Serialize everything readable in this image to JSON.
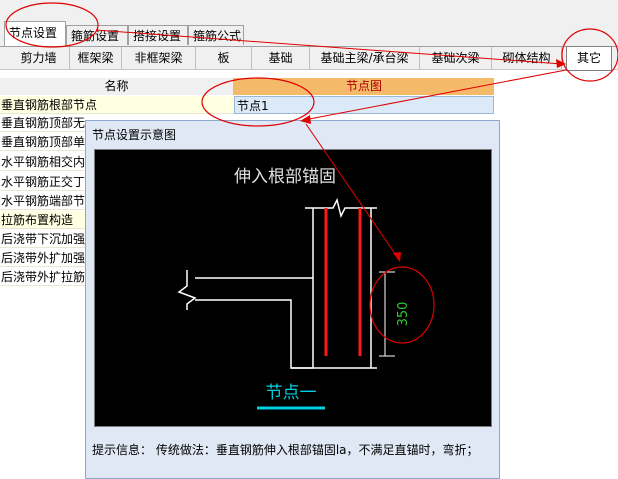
{
  "top_tabs": [
    "节点设置",
    "箍筋设置",
    "搭接设置",
    "箍筋公式"
  ],
  "sub_tabs": [
    "剪力墙",
    "框架梁",
    "非框架梁",
    "板",
    "基础",
    "基础主梁/承台梁",
    "基础次梁",
    "砌体结构",
    "其它"
  ],
  "grid": {
    "col_name": "名称",
    "col_node": "节点图",
    "rows": [
      "垂直钢筋根部节点",
      "垂直钢筋顶部无",
      "垂直钢筋顶部单",
      "水平钢筋相交内",
      "水平钢筋正交丁",
      "水平钢筋端部节",
      "拉筋布置构造",
      "后浇带下沉加强",
      "后浇带外扩加强",
      "后浇带外扩拉筋"
    ],
    "selected_value": "节点1"
  },
  "dialog": {
    "title": "节点设置示意图",
    "drawing_title": "伸入根部锚固",
    "dimension": "350",
    "node_label": "节点一",
    "tip": "提示信息： 传统做法：垂直钢筋伸入根部锚固la，不满足直锚时，弯折；"
  },
  "colors": {
    "annotation_red": "#e00000",
    "header_orange": "#f5b96a",
    "rebar_red": "#ff1a1a",
    "dimension_green": "#33cc33",
    "node_label_cyan": "#00d0e0"
  }
}
